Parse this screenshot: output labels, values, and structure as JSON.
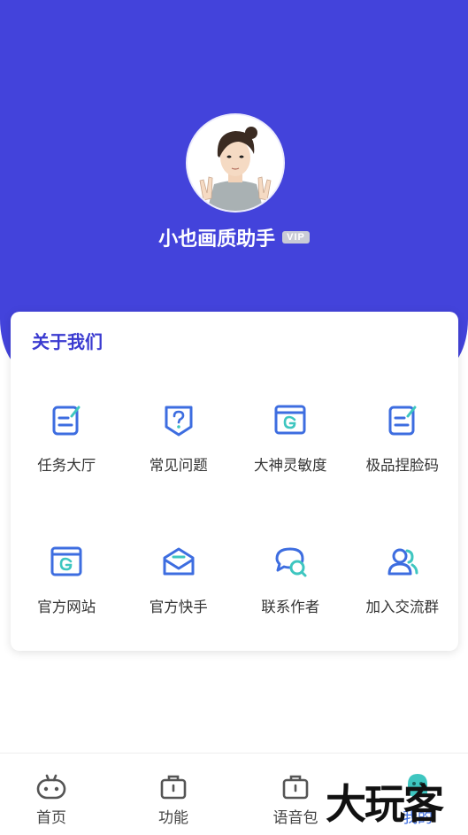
{
  "profile": {
    "username": "小也画质助手",
    "badge": "VIP"
  },
  "about": {
    "title": "关于我们",
    "items": [
      {
        "label": "任务大厅",
        "icon": "task-edit-icon"
      },
      {
        "label": "常见问题",
        "icon": "question-shield-icon"
      },
      {
        "label": "大神灵敏度",
        "icon": "g-window-icon"
      },
      {
        "label": "极品捏脸码",
        "icon": "edit-note-icon"
      },
      {
        "label": "官方网站",
        "icon": "g-window-icon"
      },
      {
        "label": "官方快手",
        "icon": "mail-open-icon"
      },
      {
        "label": "联系作者",
        "icon": "chat-bubbles-icon"
      },
      {
        "label": "加入交流群",
        "icon": "users-icon"
      }
    ]
  },
  "nav": {
    "items": [
      {
        "label": "首页",
        "icon": "gamepad-icon"
      },
      {
        "label": "功能",
        "icon": "briefcase-icon"
      },
      {
        "label": "语音包",
        "icon": "briefcase-icon"
      },
      {
        "label": "我的",
        "icon": "ghost-icon"
      }
    ]
  },
  "watermark": "大玩客",
  "colors": {
    "brand": "#4343db",
    "icon_blue": "#3d6de0",
    "icon_teal": "#3ec6c0"
  }
}
